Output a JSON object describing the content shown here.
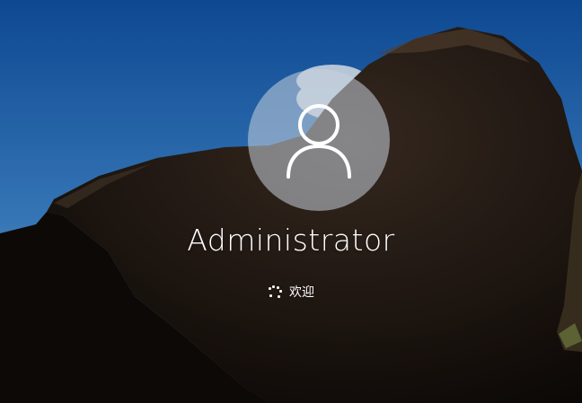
{
  "user": {
    "name": "Administrator",
    "avatar_icon": "user-icon"
  },
  "status": {
    "text": "欢迎",
    "spinner_icon": "loading-spinner-icon"
  },
  "colors": {
    "text": "#ffffff",
    "avatar_fill": "#c8d2dc",
    "sky": "#2b6db5",
    "sand": "#a97a4f",
    "cave": "#1a130f"
  }
}
